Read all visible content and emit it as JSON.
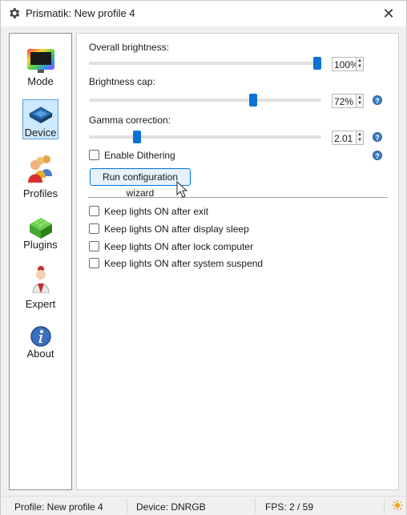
{
  "window": {
    "title": "Prismatik: New profile 4",
    "close_label": "✕"
  },
  "sidebar": {
    "items": [
      {
        "label": "Mode",
        "icon": "monitor-rainbow-icon",
        "active": false
      },
      {
        "label": "Device",
        "icon": "chip-icon",
        "active": true
      },
      {
        "label": "Profiles",
        "icon": "people-icon",
        "active": false
      },
      {
        "label": "Plugins",
        "icon": "lego-brick-icon",
        "active": false
      },
      {
        "label": "Expert",
        "icon": "expert-person-icon",
        "active": false
      },
      {
        "label": "About",
        "icon": "info-icon",
        "active": false
      }
    ]
  },
  "device": {
    "overall_brightness": {
      "label": "Overall brightness:",
      "value": "100%",
      "level_percent": 100
    },
    "brightness_cap": {
      "label": "Brightness cap:",
      "value": "72%",
      "level_percent": 72
    },
    "gamma_correction": {
      "label": "Gamma correction:",
      "value": "2.01",
      "level_fraction": 0.2
    },
    "enable_dithering": {
      "label": "Enable Dithering",
      "checked": false
    },
    "wizard_button": "Run configuration wizard",
    "keep_lights": [
      {
        "label": "Keep lights ON after exit",
        "checked": false
      },
      {
        "label": "Keep lights ON after display sleep",
        "checked": false
      },
      {
        "label": "Keep lights ON after lock computer",
        "checked": false
      },
      {
        "label": "Keep lights ON after system suspend",
        "checked": false
      }
    ],
    "help_glyph": "?"
  },
  "statusbar": {
    "profile": "Profile: New profile 4",
    "device": "Device: DNRGB",
    "fps": "FPS: 2 / 59"
  },
  "colors": {
    "accent": "#0a72d6",
    "active_nav_bg": "#cde8ff"
  }
}
